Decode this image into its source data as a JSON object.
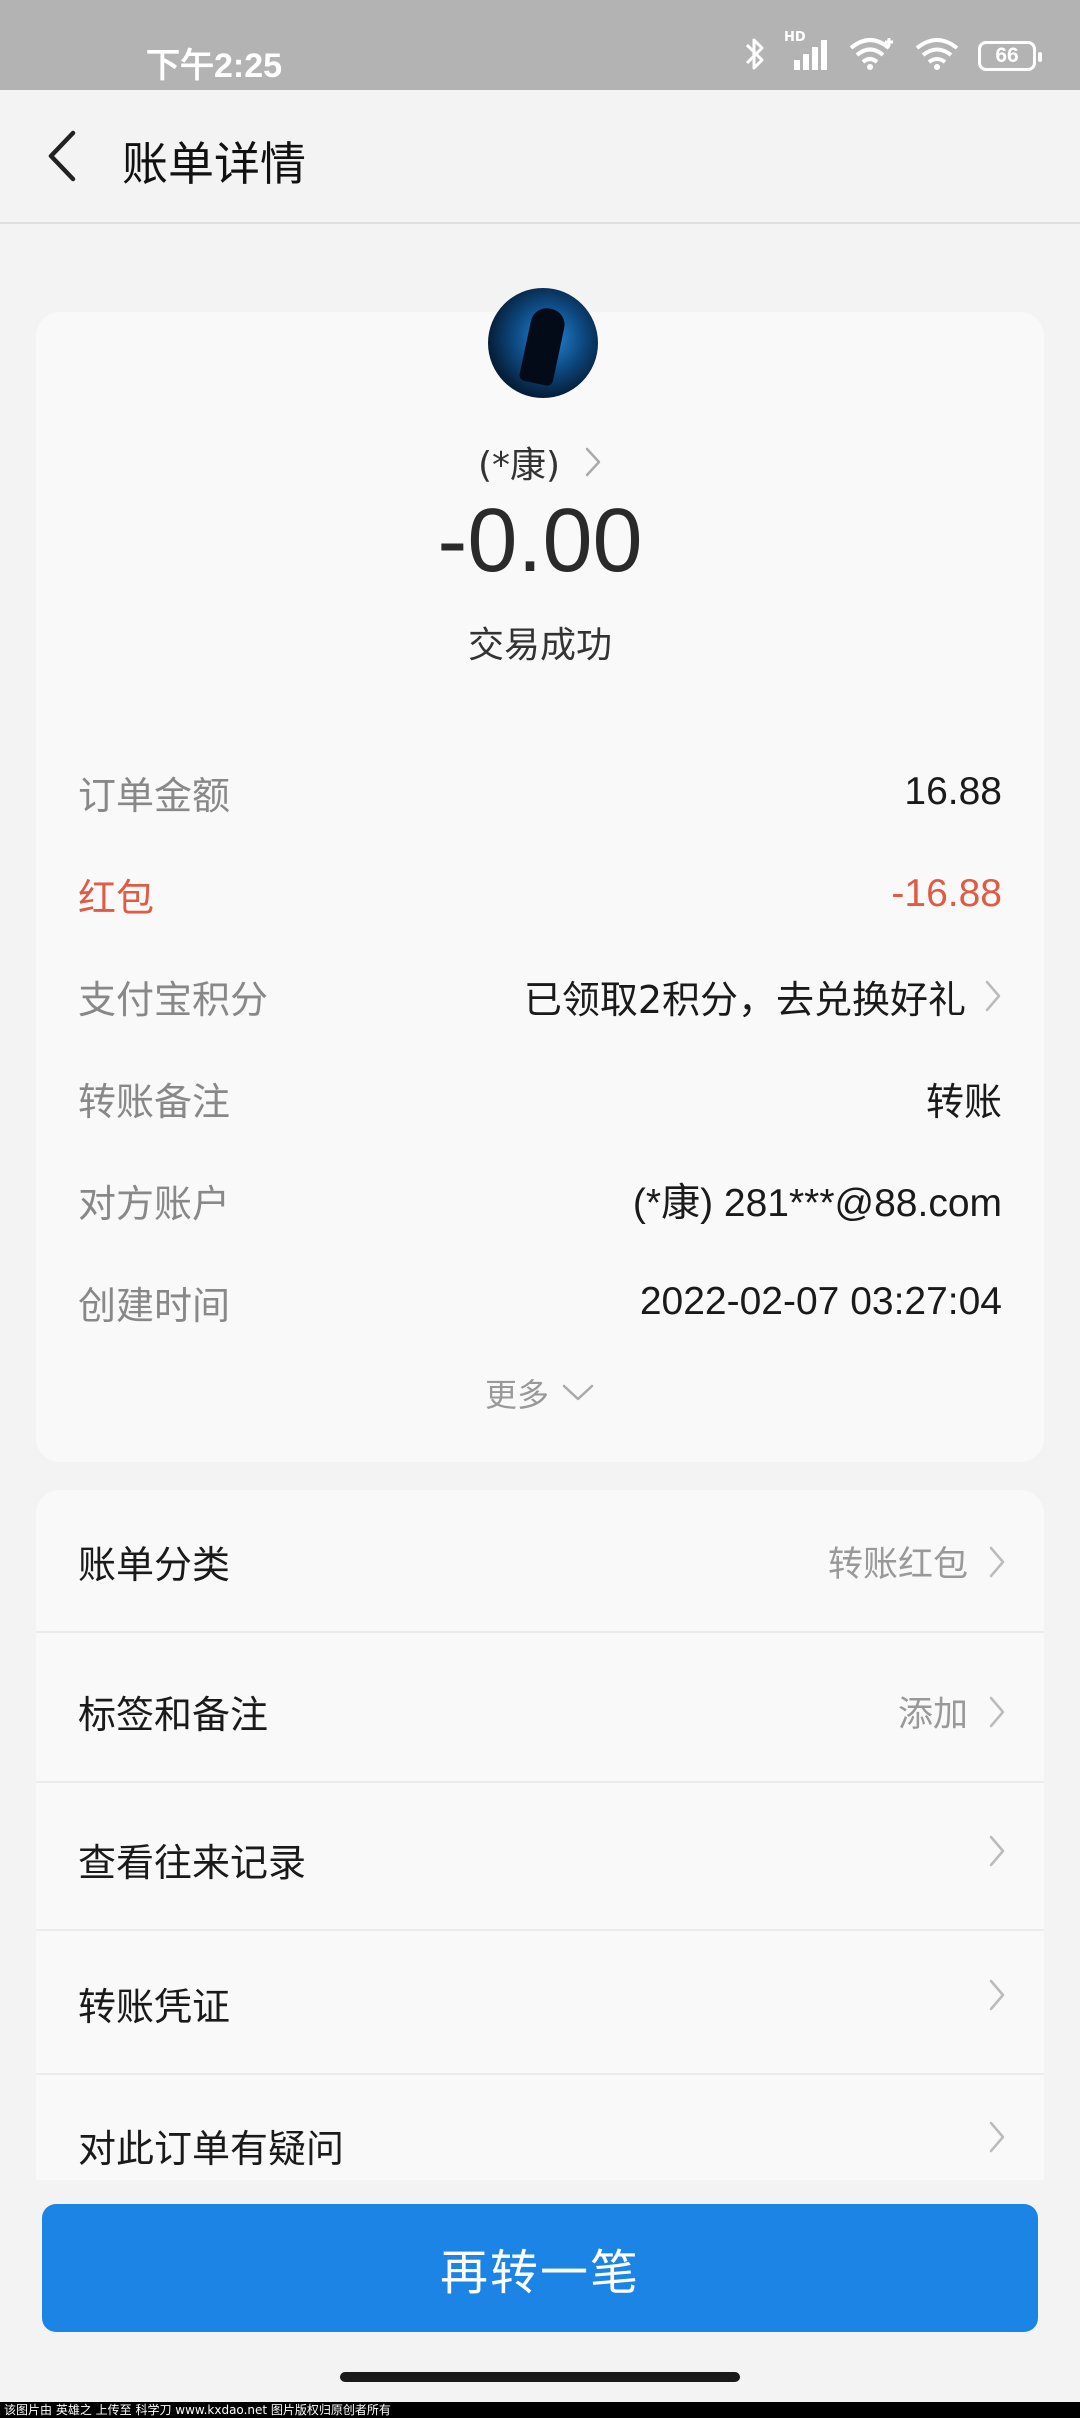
{
  "status_bar": {
    "time": "下午2:25",
    "network_label": "HD",
    "battery": "66",
    "icons": [
      "bluetooth-icon",
      "signal-icon",
      "wifi-plus-icon",
      "wifi-icon",
      "battery-icon"
    ]
  },
  "header": {
    "title": "账单详情",
    "back_icon": "chevron-left-icon"
  },
  "summary": {
    "payee_name": "(*康)",
    "amount": "-0.00",
    "status": "交易成功",
    "details": [
      {
        "label": "订单金额",
        "value": "16.88"
      },
      {
        "label": "红包",
        "value": "-16.88"
      },
      {
        "label": "支付宝积分",
        "value": "已领取2积分，去兑换好礼"
      },
      {
        "label": "转账备注",
        "value": "转账"
      },
      {
        "label": "对方账户",
        "value": "(*康) 281***@88.com"
      },
      {
        "label": "创建时间",
        "value": "2022-02-07 03:27:04"
      }
    ],
    "more_label": "更多"
  },
  "actions": [
    {
      "label": "账单分类",
      "value": "转账红包"
    },
    {
      "label": "标签和备注",
      "value": "添加"
    },
    {
      "label": "查看往来记录",
      "value": ""
    },
    {
      "label": "转账凭证",
      "value": ""
    },
    {
      "label": "对此订单有疑问",
      "value": ""
    }
  ],
  "primary_button": "再转一笔",
  "watermark": "该图片由 英雄之 上传至 科学刀 www.kxdao.net 图片版权归原创者所有",
  "colors": {
    "accent": "#1c84e4",
    "negative": "#e05a44",
    "background": "#f3f3f3",
    "card": "#f9f9f9"
  }
}
